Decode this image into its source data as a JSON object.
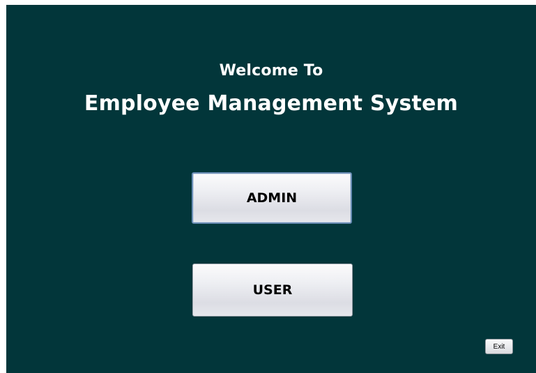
{
  "colors": {
    "window_background": "#02363a",
    "heading_text": "#ffffff",
    "button_text": "#000000",
    "focused_button_border": "#6a8db5"
  },
  "header": {
    "welcome": "Welcome To",
    "title": "Employee Management System"
  },
  "buttons": {
    "admin_label": "ADMIN",
    "user_label": "USER",
    "exit_label": "Exit"
  }
}
